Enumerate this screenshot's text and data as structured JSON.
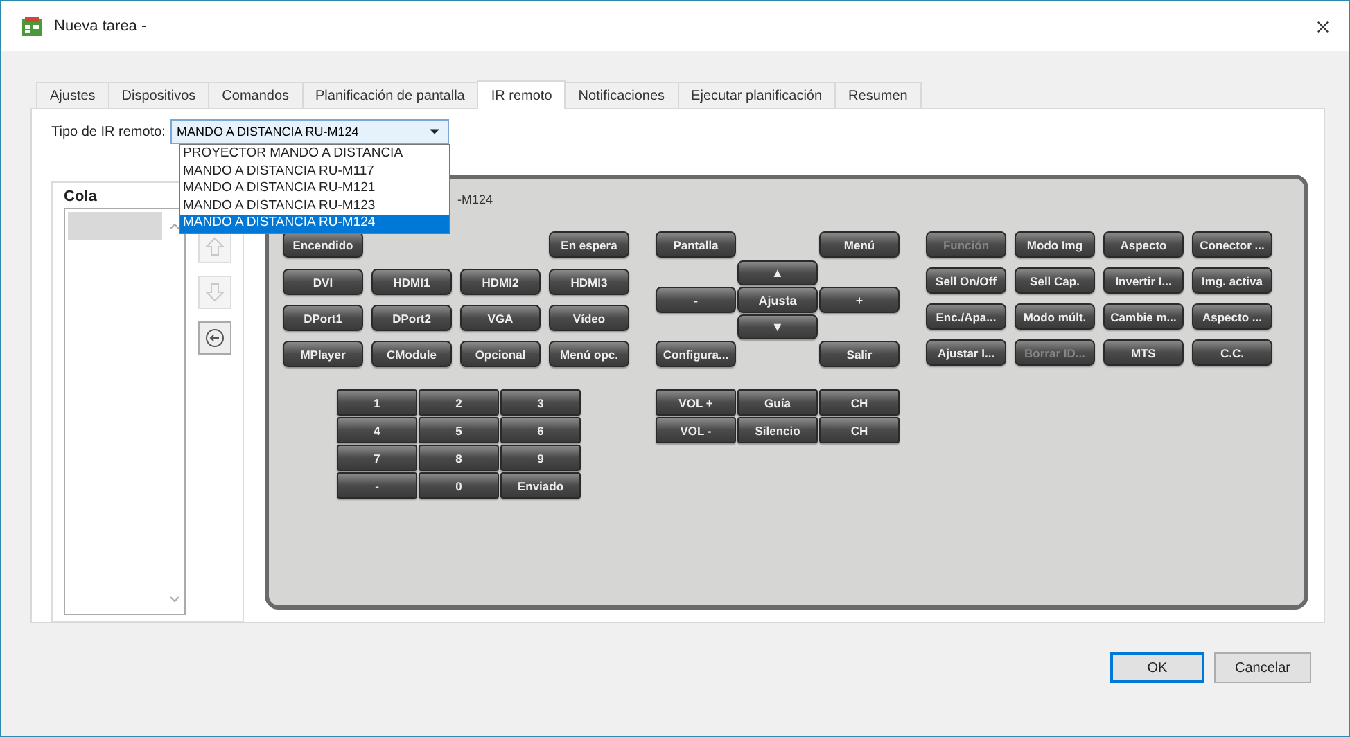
{
  "window": {
    "title": "Nueva tarea -"
  },
  "tabs": [
    {
      "label": "Ajustes",
      "selected": false
    },
    {
      "label": "Dispositivos",
      "selected": false
    },
    {
      "label": "Comandos",
      "selected": false
    },
    {
      "label": "Planificación de pantalla",
      "selected": false
    },
    {
      "label": "IR remoto",
      "selected": true
    },
    {
      "label": "Notificaciones",
      "selected": false
    },
    {
      "label": "Ejecutar planificación",
      "selected": false
    },
    {
      "label": "Resumen",
      "selected": false
    }
  ],
  "remote_type": {
    "label": "Tipo de IR remoto:",
    "value": "MANDO A DISTANCIA RU-M124",
    "expanded": true,
    "options": [
      {
        "label": "PROYECTOR MANDO A DISTANCIA",
        "selected": false
      },
      {
        "label": "MANDO A DISTANCIA RU-M117",
        "selected": false
      },
      {
        "label": "MANDO A DISTANCIA RU-M121",
        "selected": false
      },
      {
        "label": "MANDO A DISTANCIA RU-M123",
        "selected": false
      },
      {
        "label": "MANDO A DISTANCIA RU-M124",
        "selected": true
      }
    ]
  },
  "queue": {
    "title": "Cola",
    "controls": [
      {
        "kind": "up",
        "disabled": true
      },
      {
        "kind": "down",
        "disabled": true
      },
      {
        "kind": "remove",
        "disabled": false
      }
    ]
  },
  "remote": {
    "label": "-M124",
    "top": [
      "Encendido",
      "En espera"
    ],
    "inputs": [
      "DVI",
      "HDMI1",
      "HDMI2",
      "HDMI3",
      "DPort1",
      "DPort2",
      "VGA",
      "Vídeo",
      "MPlayer",
      "CModule",
      "Opcional",
      "Menú opc."
    ],
    "keypad": [
      "1",
      "2",
      "3",
      "4",
      "5",
      "6",
      "7",
      "8",
      "9",
      "-",
      "0",
      "Enviado"
    ],
    "nav_top": [
      "Pantalla",
      "Menú"
    ],
    "dpad": {
      "up": "▲",
      "left": "-",
      "center": "Ajusta",
      "right": "+",
      "down": "▼"
    },
    "nav_bottom": [
      "Configura...",
      "Salir"
    ],
    "volume": [
      "VOL +",
      "Guía",
      "CH",
      "VOL -",
      "Silencio",
      "CH"
    ],
    "functions": [
      {
        "label": "Función",
        "disabled": true
      },
      {
        "label": "Modo Img",
        "disabled": false
      },
      {
        "label": "Aspecto",
        "disabled": false
      },
      {
        "label": "Conector ...",
        "disabled": false
      },
      {
        "label": "Sell On/Off",
        "disabled": false
      },
      {
        "label": "Sell Cap.",
        "disabled": false
      },
      {
        "label": "Invertir I...",
        "disabled": false
      },
      {
        "label": "Img. activa",
        "disabled": false
      },
      {
        "label": "Enc./Apa...",
        "disabled": false
      },
      {
        "label": "Modo múlt.",
        "disabled": false
      },
      {
        "label": "Cambie m...",
        "disabled": false
      },
      {
        "label": "Aspecto ...",
        "disabled": false
      },
      {
        "label": "Ajustar I...",
        "disabled": false
      },
      {
        "label": "Borrar ID...",
        "disabled": true
      },
      {
        "label": "MTS",
        "disabled": false
      },
      {
        "label": "C.C.",
        "disabled": false
      }
    ]
  },
  "buttons": [
    {
      "label": "OK",
      "kind": "default"
    },
    {
      "label": "Cancelar",
      "kind": "normal"
    }
  ]
}
